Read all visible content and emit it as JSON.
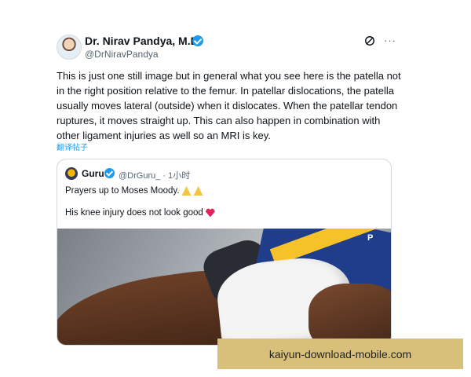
{
  "post": {
    "author_name": "Dr. Nirav Pandya, M.D.",
    "author_handle": "@DrNiravPandya",
    "more_label": "···",
    "body": "This is just one still image but in general what you see here is the patella not in the right position relative to the femur. In patellar dislocations, the patella usually moves lateral (outside) when it dislocates.  When the patellar tendon ruptures, it moves straight up.  This can also happen in combination with other ligament injuries as well so an MRI is key.",
    "translate_label": "翻译帖子"
  },
  "quote": {
    "author_name": "Guru",
    "meta": "@DrGuru_ · 1小时",
    "line1": "Prayers up to Moses Moody.",
    "line2": "His knee injury does not look good",
    "photo_badge": "P"
  },
  "banner": {
    "text": "kaiyun-download-mobile.com"
  },
  "colors": {
    "accent": "#1d9bf0",
    "banner_bg": "#d9c07a"
  },
  "icons": [
    "verified-badge-icon",
    "grok-icon",
    "more-icon",
    "pray-icon",
    "broken-heart-icon"
  ]
}
